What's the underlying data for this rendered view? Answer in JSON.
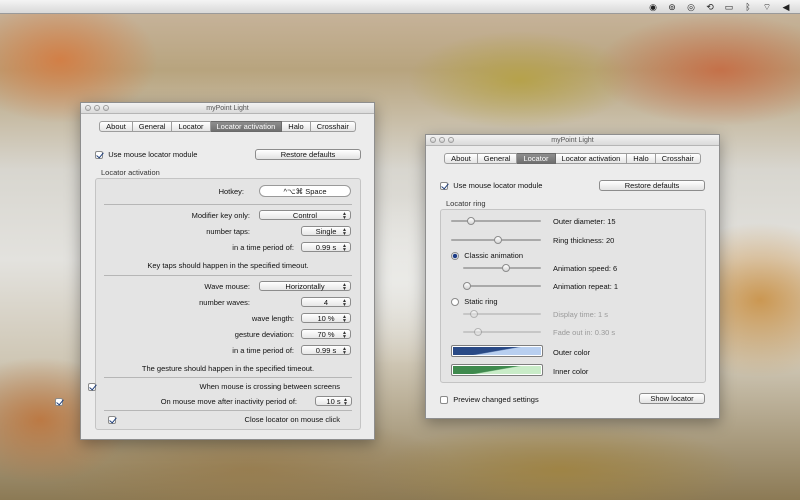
{
  "menubar": {
    "icons": [
      "radio-icon",
      "status-icon",
      "status-icon",
      "time-machine-icon",
      "display-icon",
      "bluetooth-icon",
      "wifi-icon",
      "volume-icon"
    ]
  },
  "window_general": {
    "title": "myPoint Light",
    "tabs": [
      "About",
      "General",
      "Locator",
      "Locator activation",
      "Halo",
      "Crosshair"
    ],
    "active_tab": "Locator activation",
    "use_module_label": "Use mouse locator module",
    "use_module_checked": true,
    "restore_label": "Restore defaults",
    "section_label": "Locator activation",
    "hotkey_label": "Hotkey:",
    "hotkey_value": "^⌥⌘ Space",
    "modifier_label": "Modifier key only:",
    "modifier_value": "Control",
    "taps_label": "number taps:",
    "taps_value": "Single",
    "tap_period_label": "in a time period of:",
    "tap_period_value": "0.99 s",
    "taps_note": "Key taps should happen in the specified timeout.",
    "wave_label": "Wave mouse:",
    "wave_value": "Horizontally",
    "waves_label": "number waves:",
    "waves_value": "4",
    "wavelength_label": "wave length:",
    "wavelength_value": "10 %",
    "deviation_label": "gesture deviation:",
    "deviation_value": "70 %",
    "wave_period_label": "in a time period of:",
    "wave_period_value": "0.99 s",
    "gesture_note": "The gesture should happen in the specified timeout.",
    "crossing_label": "When mouse is crossing between screens",
    "crossing_checked": true,
    "inactivity_label": "On mouse move after inactivity period of:",
    "inactivity_checked": true,
    "inactivity_value": "10 s",
    "close_label": "Close locator on mouse click",
    "close_checked": true
  },
  "window_locator": {
    "title": "myPoint Light",
    "tabs": [
      "About",
      "General",
      "Locator",
      "Locator activation",
      "Halo",
      "Crosshair"
    ],
    "active_tab": "Locator",
    "use_module_label": "Use mouse locator module",
    "use_module_checked": true,
    "restore_label": "Restore defaults",
    "section_label": "Locator ring",
    "outer_diameter_label": "Outer diameter: 15",
    "outer_diameter_level": 0.2,
    "ring_thickness_label": "Ring thickness: 20",
    "ring_thickness_level": 0.53,
    "classic_label": "Classic animation",
    "classic_selected": true,
    "anim_speed_label": "Animation speed: 6",
    "anim_speed_level": 0.55,
    "anim_repeat_label": "Animation repeat: 1",
    "anim_repeat_level": 0.0,
    "static_label": "Static ring",
    "static_selected": false,
    "display_time_label": "Display time: 1 s",
    "display_time_level": 0.1,
    "fade_out_label": "Fade out in: 0.30 s",
    "fade_out_level": 0.15,
    "outer_color_label": "Outer color",
    "outer_color": "#2a4a86",
    "outer_color_light": "#b8cff0",
    "inner_color_label": "Inner color",
    "inner_color": "#3f8a4e",
    "inner_color_light": "#c9ecc8",
    "preview_label": "Preview changed settings",
    "preview_checked": false,
    "show_locator_label": "Show locator"
  }
}
